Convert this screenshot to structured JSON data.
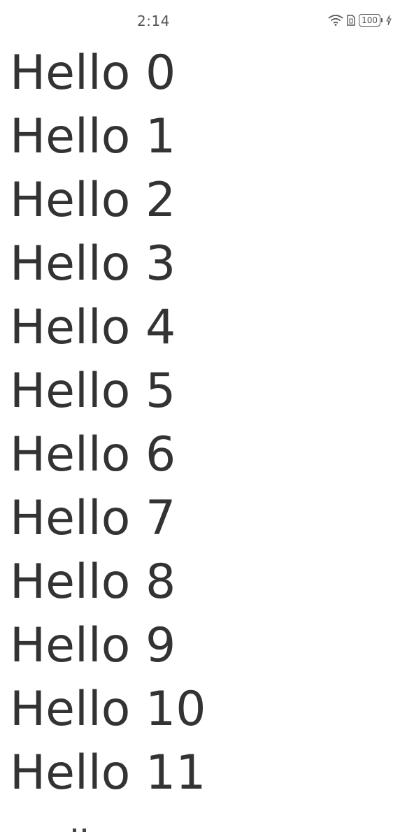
{
  "status_bar": {
    "time": "2:14",
    "battery_level": "100",
    "icons": [
      "wifi-icon",
      "sim-card-icon",
      "battery-icon",
      "charging-icon"
    ]
  },
  "list": {
    "items": [
      "Hello 0",
      "Hello 1",
      "Hello 2",
      "Hello 3",
      "Hello 4",
      "Hello 5",
      "Hello 6",
      "Hello 7",
      "Hello 8",
      "Hello 9",
      "Hello 10",
      "Hello 11"
    ]
  },
  "colors": {
    "text": "#333333",
    "background": "#ffffff",
    "status": "#555555"
  }
}
